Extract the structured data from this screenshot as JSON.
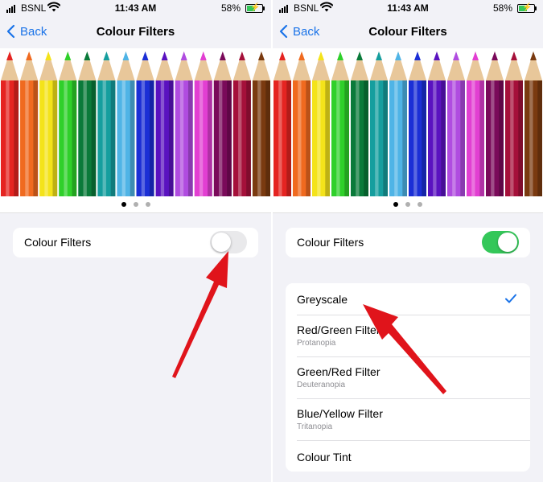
{
  "status_bar": {
    "carrier": "BSNL",
    "time": "11:43 AM",
    "battery_percent": "58%",
    "battery_level": 0.58
  },
  "nav": {
    "back_label": "Back",
    "title": "Colour Filters"
  },
  "pencil_colors": [
    "#e52421",
    "#f06a1f",
    "#f4e31a",
    "#2fd02a",
    "#0a7a3a",
    "#159e9e",
    "#4fb4e6",
    "#1b2fd6",
    "#5a12c0",
    "#b04ce0",
    "#e23fd2",
    "#7a0a5a",
    "#a5103a",
    "#7a3a10"
  ],
  "pagination": {
    "count": 3,
    "active": 0
  },
  "left": {
    "toggle_label": "Colour Filters",
    "toggle_on": false
  },
  "right": {
    "toggle_label": "Colour Filters",
    "toggle_on": true,
    "filters": [
      {
        "name": "Greyscale",
        "subtitle": "",
        "selected": true
      },
      {
        "name": "Red/Green Filter",
        "subtitle": "Protanopia",
        "selected": false
      },
      {
        "name": "Green/Red Filter",
        "subtitle": "Deuteranopia",
        "selected": false
      },
      {
        "name": "Blue/Yellow Filter",
        "subtitle": "Tritanopia",
        "selected": false
      },
      {
        "name": "Colour Tint",
        "subtitle": "",
        "selected": false
      }
    ]
  },
  "colors": {
    "accent": "#1a73e8",
    "toggle_on": "#34c759",
    "annotation_arrow": "#e0141b"
  }
}
